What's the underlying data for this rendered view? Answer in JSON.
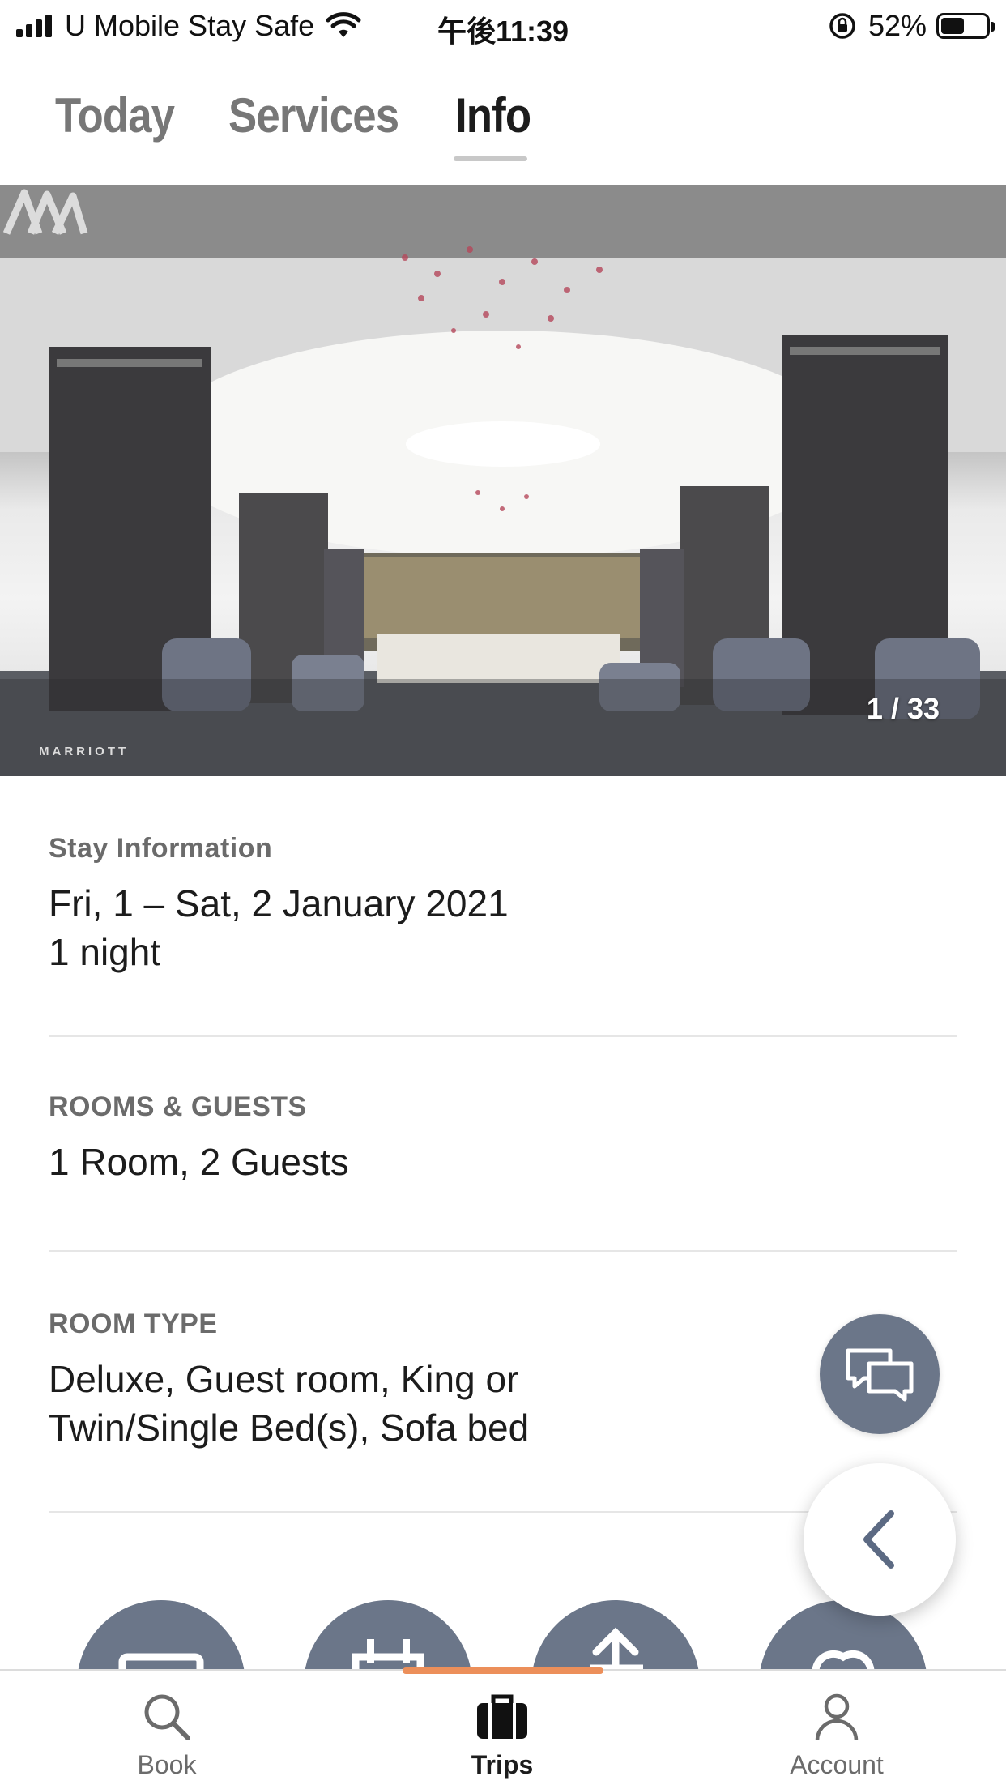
{
  "status_bar": {
    "carrier": "U Mobile Stay Safe",
    "time": "午後11:39",
    "battery_percent": "52%",
    "battery_level": 0.52
  },
  "tabs": [
    {
      "label": "Today",
      "active": false
    },
    {
      "label": "Services",
      "active": false
    },
    {
      "label": "Info",
      "active": true
    }
  ],
  "hero": {
    "counter": "1 / 33",
    "brand_text": "MARRIOTT"
  },
  "stay": {
    "label": "Stay Information",
    "dates": "Fri, 1 – Sat, 2 January 2021",
    "nights": "1 night"
  },
  "rooms": {
    "label": "ROOMS & GUESTS",
    "value": "1 Room, 2 Guests"
  },
  "room_type": {
    "label": "ROOM TYPE",
    "line1": "Deluxe, Guest room,  King or",
    "line2": "Twin/Single Bed(s), Sofa bed"
  },
  "fabs": {
    "chat_icon": "chat-bubbles-icon",
    "back_icon": "chevron-left-icon"
  },
  "actions": [
    {
      "icon": "card-icon"
    },
    {
      "icon": "calendar-icon"
    },
    {
      "icon": "upload-icon"
    },
    {
      "icon": "link-icon"
    }
  ],
  "bottom_nav": [
    {
      "label": "Book",
      "icon": "search-icon",
      "active": false
    },
    {
      "label": "Trips",
      "icon": "suitcase-icon",
      "active": true
    },
    {
      "label": "Account",
      "icon": "person-icon",
      "active": false
    }
  ],
  "colors": {
    "accent": "#ec8f5a",
    "fab_gray": "#6b7689",
    "muted_text": "#6b6b6b"
  }
}
